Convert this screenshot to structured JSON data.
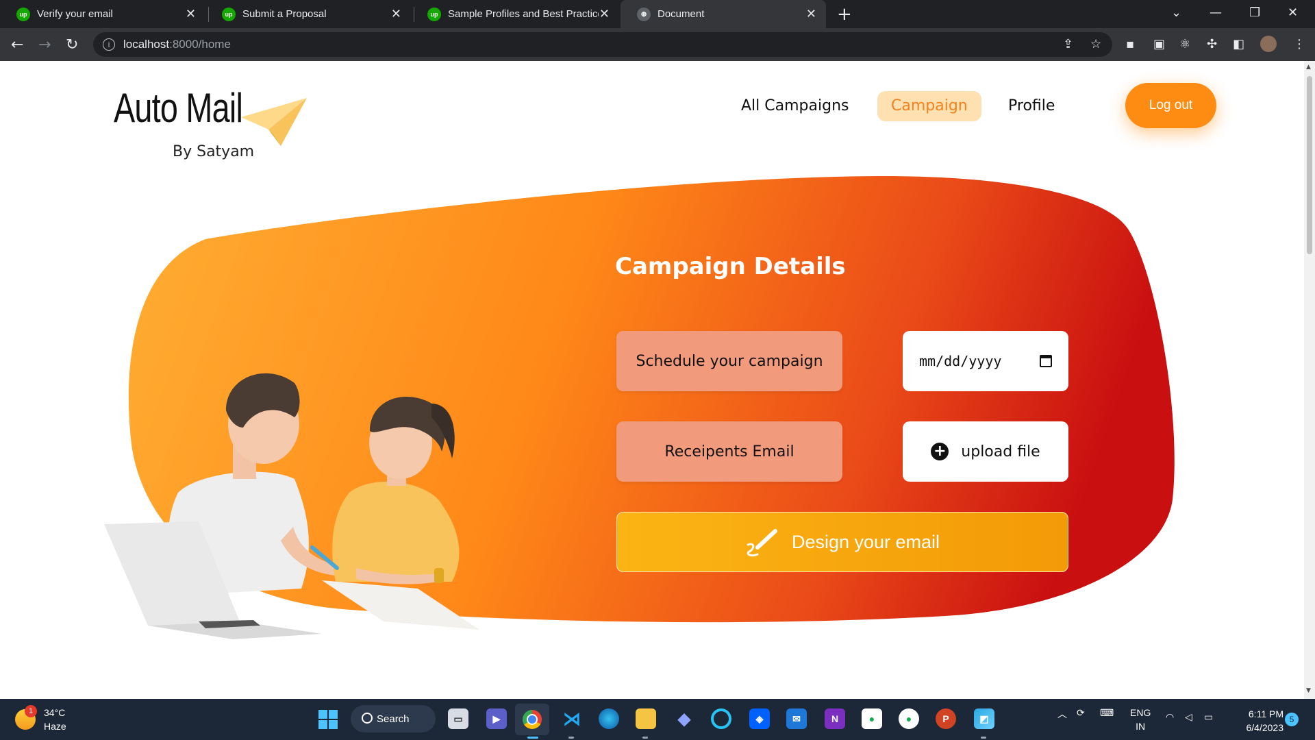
{
  "browser": {
    "tabs": [
      {
        "title": "Verify your email",
        "favicon": "upwork-icon",
        "active": false
      },
      {
        "title": "Submit a Proposal",
        "favicon": "upwork-icon",
        "active": false
      },
      {
        "title": "Sample Profiles and Best Practice",
        "favicon": "upwork-icon",
        "active": false
      },
      {
        "title": "Document",
        "favicon": "globe-icon",
        "active": true
      }
    ],
    "url_host": "localhost",
    "url_path": ":8000/home",
    "favicon_text": "up"
  },
  "header": {
    "logo_title": "Auto Mail",
    "logo_subtitle": "By Satyam",
    "nav": [
      {
        "label": "All Campaigns",
        "active": false
      },
      {
        "label": "Campaign",
        "active": true
      },
      {
        "label": "Profile",
        "active": false
      }
    ],
    "logout_label": "Log out"
  },
  "campaign": {
    "title": "Campaign Details",
    "schedule_label": "Schedule your campaign",
    "date_placeholder": "mm/dd/yyyy",
    "recipients_label": "Receipents Email",
    "upload_label": "upload file",
    "design_label": "Design your email"
  },
  "taskbar": {
    "weather_temp": "34°C",
    "weather_desc": "Haze",
    "weather_badge": "1",
    "search_label": "Search",
    "lang_top": "ENG",
    "lang_bottom": "IN",
    "time": "6:11 PM",
    "date": "6/4/2023",
    "notification_count": "5"
  },
  "colors": {
    "accent": "#ff8c12",
    "nav_active_bg": "#ffe0b0",
    "nav_active_text": "#f5811e",
    "blob_start": "#ffa52c",
    "blob_end": "#cf1311",
    "peach": "#f29b7c",
    "design_btn": "#f7a80c"
  }
}
